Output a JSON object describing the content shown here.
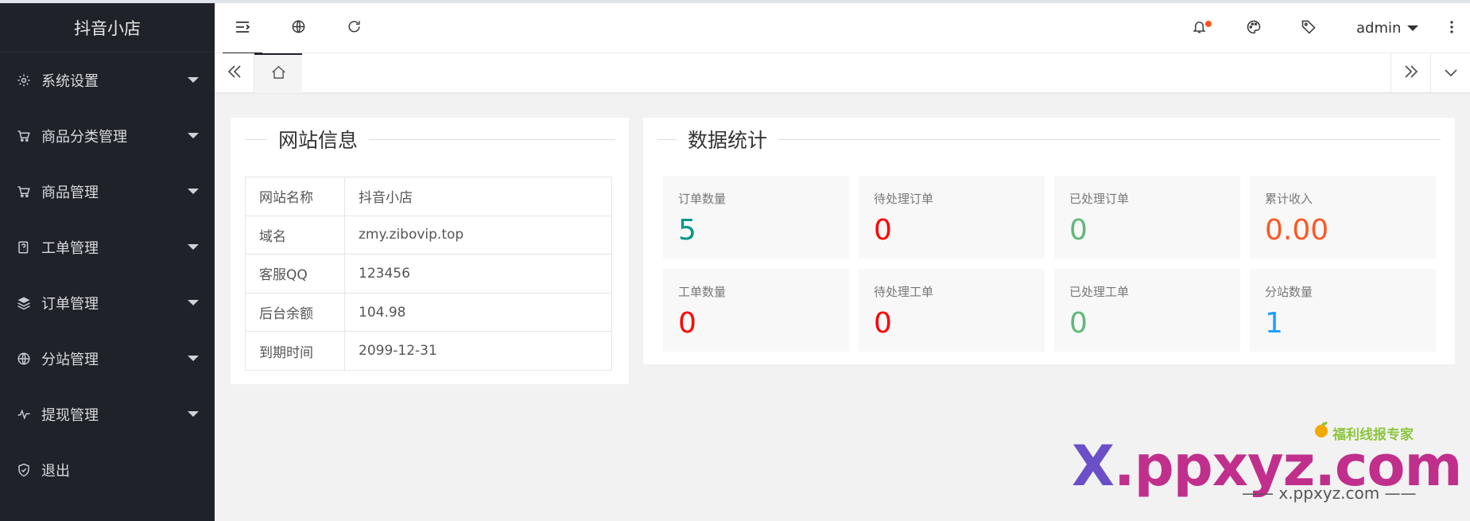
{
  "app": {
    "brand": "抖音小店"
  },
  "sidebar": {
    "items": [
      {
        "label": "系统设置",
        "icon": "gear-icon"
      },
      {
        "label": "商品分类管理",
        "icon": "cart-icon"
      },
      {
        "label": "商品管理",
        "icon": "cart-icon"
      },
      {
        "label": "工单管理",
        "icon": "ticket-icon"
      },
      {
        "label": "订单管理",
        "icon": "layers-icon"
      },
      {
        "label": "分站管理",
        "icon": "globe-icon"
      },
      {
        "label": "提现管理",
        "icon": "pulse-icon"
      },
      {
        "label": "退出",
        "icon": "shield-icon"
      }
    ]
  },
  "header": {
    "user": "admin",
    "notification_dot_color": "#ff5722"
  },
  "site_info": {
    "title": "网站信息",
    "rows": [
      {
        "key": "网站名称",
        "value": "抖音小店"
      },
      {
        "key": "域名",
        "value": "zmy.zibovip.top"
      },
      {
        "key": "客服QQ",
        "value": "123456"
      },
      {
        "key": "后台余额",
        "value": "104.98"
      },
      {
        "key": "到期时间",
        "value": "2099-12-31"
      }
    ]
  },
  "stats": {
    "title": "数据统计",
    "items": [
      {
        "label": "订单数量",
        "value": "5",
        "color": "#009688"
      },
      {
        "label": "待处理订单",
        "value": "0",
        "color": "#ff0000"
      },
      {
        "label": "已处理订单",
        "value": "0",
        "color": "#5fb878"
      },
      {
        "label": "累计收入",
        "value": "0.00",
        "color": "#ff5722"
      },
      {
        "label": "工单数量",
        "value": "0",
        "color": "#ff0000"
      },
      {
        "label": "待处理工单",
        "value": "0",
        "color": "#ff0000"
      },
      {
        "label": "已处理工单",
        "value": "0",
        "color": "#5fb878"
      },
      {
        "label": "分站数量",
        "value": "1",
        "color": "#1e9fff"
      }
    ]
  },
  "watermark": {
    "main_x": "X",
    "main_rest": ".ppxyz.com",
    "sub": "—— x.ppxyz.com ——",
    "tag": "福利线报专家"
  }
}
